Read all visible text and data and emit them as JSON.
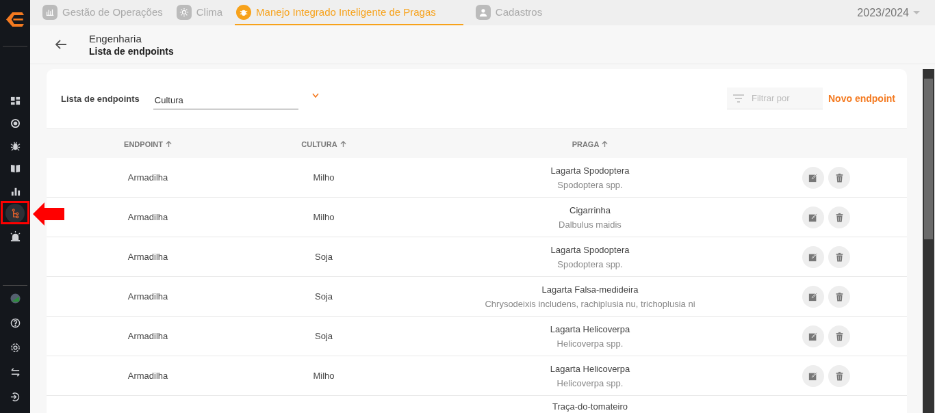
{
  "modules": [
    {
      "kind": "operations",
      "label": "Gestão de Operações",
      "selected": false
    },
    {
      "kind": "weather",
      "label": "Clima",
      "selected": false
    },
    {
      "kind": "pests",
      "label": "Manejo Integrado Inteligente de Pragas",
      "selected": true
    },
    {
      "kind": "registry",
      "label": "Cadastros",
      "selected": false
    }
  ],
  "season": "2023/2024",
  "breadcrumb": {
    "parent": "Engenharia",
    "title": "Lista de endpoints"
  },
  "sidebar": {
    "items": [
      {
        "kind": "dashboard",
        "selected": false
      },
      {
        "kind": "signal",
        "selected": false
      },
      {
        "kind": "bug",
        "selected": false
      },
      {
        "kind": "book",
        "selected": false
      },
      {
        "kind": "chart",
        "selected": false
      },
      {
        "kind": "tree",
        "selected": true
      },
      {
        "kind": "alarm",
        "selected": false
      }
    ],
    "bottom": [
      {
        "kind": "avatar"
      },
      {
        "kind": "help"
      },
      {
        "kind": "settings"
      },
      {
        "kind": "swap"
      },
      {
        "kind": "logout"
      }
    ]
  },
  "toolbar": {
    "label": "Lista de endpoints",
    "select_value": "Cultura",
    "filter_placeholder": "Filtrar por",
    "button": "Novo endpoint"
  },
  "table": {
    "columns": [
      "ENDPOINT",
      "CULTURA",
      "PRAGA"
    ],
    "rows": [
      {
        "endpoint": "Armadilha",
        "cultura": "Milho",
        "praga": "Lagarta Spodoptera",
        "species": "Spodoptera spp."
      },
      {
        "endpoint": "Armadilha",
        "cultura": "Milho",
        "praga": "Cigarrinha",
        "species": "Dalbulus maidis"
      },
      {
        "endpoint": "Armadilha",
        "cultura": "Soja",
        "praga": "Lagarta Spodoptera",
        "species": "Spodoptera spp."
      },
      {
        "endpoint": "Armadilha",
        "cultura": "Soja",
        "praga": "Lagarta Falsa-medideira",
        "species": "Chrysodeixis includens, rachiplusia nu, trichoplusia ni"
      },
      {
        "endpoint": "Armadilha",
        "cultura": "Soja",
        "praga": "Lagarta Helicoverpa",
        "species": "Helicoverpa spp."
      },
      {
        "endpoint": "Armadilha",
        "cultura": "Milho",
        "praga": "Lagarta Helicoverpa",
        "species": "Helicoverpa spp."
      },
      {
        "praga": "Traça-do-tomateiro"
      }
    ]
  }
}
